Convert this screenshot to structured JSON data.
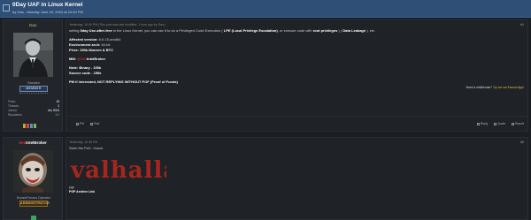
{
  "thread": {
    "title": "0Day UAF in Linux Kernel",
    "byline": "by Gao - Monday June 24, 2024 at 10:40 PM"
  },
  "posts": [
    {
      "author": {
        "name": "Gao",
        "usertitle": "Branded",
        "rank": "MEMBER",
        "stats": [
          {
            "label": "Posts:",
            "value": "18"
          },
          {
            "label": "Threads:",
            "value": "3"
          },
          {
            "label": "Joined:",
            "value": "Jun 2024"
          },
          {
            "label": "Reputation:",
            "value": "111"
          }
        ]
      },
      "date": "Yesterday, 10:40 PM (This post was last modified: 1 hour ago by Gao.)",
      "number": "#1",
      "body": {
        "line1_pre": "selling ",
        "line1_b1": "0day Use-after-free",
        "line1_mid": " in the Linux Kernel, you can use it to do a Privileged Code Execution ( ",
        "line1_b2": "LPE (Local Privilege Escalation)",
        "line1_mid2": ", or execute code with ",
        "line1_b3": "root privileges",
        "line1_mid3": " ) ( ",
        "line1_b4": "Data Leakage",
        "line1_end": " ), etc.",
        "affected_label": "Affected version:",
        "affected_value": " 6.6.15-amd64",
        "env_label": "Environment arch:",
        "env_value": " 64-bit",
        "price_label": "Price: 150k Monero & BTC",
        "mm_label": "MM: ",
        "mm_red": "@Sec",
        "mm_white": "IntelBroker",
        "note_binary": "Note: Binary - 150k",
        "note_source": "Source code - 150k",
        "pm": "PM if interested, NOT REPLYING WITHOUT POF (Proof of Funds)"
      },
      "promo": {
        "pre": "Need a middleman? ",
        "link": "Try out our Escrow App!"
      },
      "actions_left": [
        "PM",
        "Find"
      ],
      "actions_right": [
        "Reply",
        "Quote",
        "Report"
      ]
    },
    {
      "author": {
        "name_red": "Sec",
        "name_white": "IntelBroker",
        "usertitle": "BreachForums Operator",
        "rank": "ADMINISTRATOR"
      },
      "date": "Yesterday, 10:48 PM",
      "number": "#2",
      "body": {
        "line": "Seen the PoC. Vouch."
      },
      "signature": {
        "logo_text": "valhalla",
        "line1": "pgp",
        "line2": "PGP Archive Link"
      }
    }
  ],
  "colors": {
    "header_bg": "#2f4f76",
    "page_bg": "#1b1e22",
    "accent_red": "#e23434",
    "name_green": "#b9d17a",
    "reputation_green": "#5fc25b"
  }
}
